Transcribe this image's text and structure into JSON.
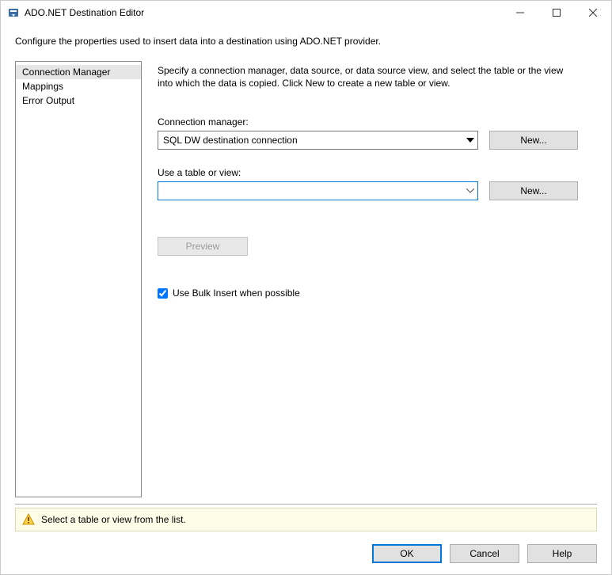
{
  "window": {
    "title": "ADO.NET Destination Editor"
  },
  "description": "Configure the properties used to insert data into a destination using ADO.NET provider.",
  "sidebar": {
    "items": [
      {
        "label": "Connection Manager",
        "selected": true
      },
      {
        "label": "Mappings",
        "selected": false
      },
      {
        "label": "Error Output",
        "selected": false
      }
    ]
  },
  "content": {
    "instruction": "Specify a connection manager, data source, or data source view, and select the table or the view into which the data is copied. Click New to create a new table or view.",
    "connection_label": "Connection manager:",
    "connection_value": "SQL DW destination connection",
    "connection_new": "New...",
    "table_label": "Use a table or view:",
    "table_value": "",
    "table_new": "New...",
    "preview": "Preview",
    "bulk_insert_label": "Use Bulk Insert when possible",
    "bulk_insert_checked": true
  },
  "status": {
    "message": "Select a table or view from the list."
  },
  "footer": {
    "ok": "OK",
    "cancel": "Cancel",
    "help": "Help"
  }
}
